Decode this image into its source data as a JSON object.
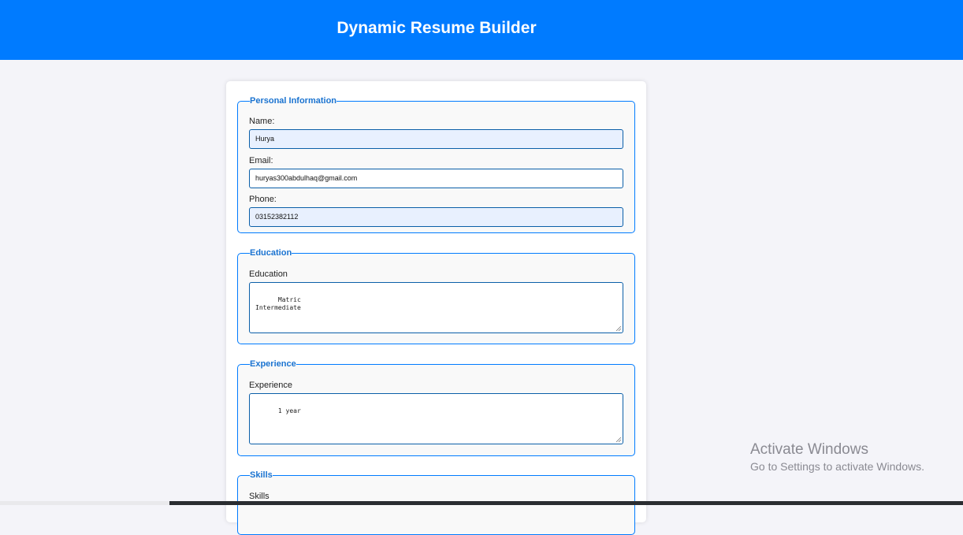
{
  "header": {
    "title": "Dynamic Resume Builder"
  },
  "personal": {
    "legend": "Personal Information",
    "name_label": "Name:",
    "name_value": "Hurya",
    "email_label": "Email:",
    "email_value": "huryas300abdulhaq@gmail.com",
    "phone_label": "Phone:",
    "phone_value": "03152382112"
  },
  "education": {
    "legend": "Education",
    "label": "Education",
    "value": "Matric\nIntermediate"
  },
  "experience": {
    "legend": "Experience",
    "label": "Experience",
    "value": "1 year"
  },
  "skills": {
    "legend": "Skills",
    "label": "Skills"
  },
  "watermark": {
    "title": "Activate Windows",
    "subtitle": "Go to Settings to activate Windows."
  },
  "colors": {
    "header_bg": "#007bff",
    "accent": "#007bff",
    "legend_text": "#1a73d0",
    "autofill_bg": "#e8f0fe",
    "page_bg": "#f4f4f9"
  }
}
